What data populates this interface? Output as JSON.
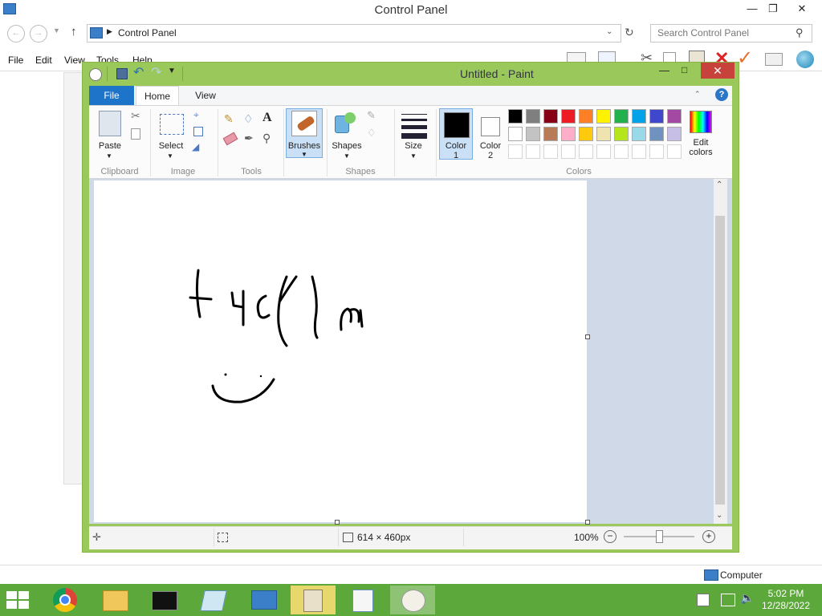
{
  "control_panel": {
    "title": "Control Panel",
    "breadcrumb": "Control Panel",
    "search_placeholder": "Search Control Panel",
    "menu": [
      "File",
      "Edit",
      "View",
      "Tools",
      "Help"
    ],
    "status_computer": "Computer"
  },
  "paint": {
    "title": "Untitled - Paint",
    "tabs": {
      "file": "File",
      "home": "Home",
      "view": "View"
    },
    "ribbon": {
      "paste": "Paste",
      "clipboard": "Clipboard",
      "select": "Select",
      "image": "Image",
      "tools": "Tools",
      "brushes": "Brushes",
      "shapes_btn": "Shapes",
      "shapes": "Shapes",
      "size": "Size",
      "color1_line1": "Color",
      "color1_line2": "1",
      "color2_line1": "Color",
      "color2_line2": "2",
      "edit_colors_line1": "Edit",
      "edit_colors_line2": "colors",
      "colors": "Colors"
    },
    "palette_row1": [
      "#000000",
      "#7f7f7f",
      "#880015",
      "#ed1c24",
      "#ff7f27",
      "#fff200",
      "#22b14c",
      "#00a2e8",
      "#3f48cc",
      "#a349a4"
    ],
    "palette_row2": [
      "#ffffff",
      "#c3c3c3",
      "#b97a57",
      "#ffaec9",
      "#ffc90e",
      "#efe4b0",
      "#b5e61d",
      "#99d9ea",
      "#7092be",
      "#c8bfe7"
    ],
    "color1": "#000000",
    "color2": "#ffffff",
    "status": {
      "dimensions": "614 × 460px",
      "zoom": "100%"
    }
  },
  "taskbar": {
    "time": "5:02 PM",
    "date": "12/28/2022"
  }
}
